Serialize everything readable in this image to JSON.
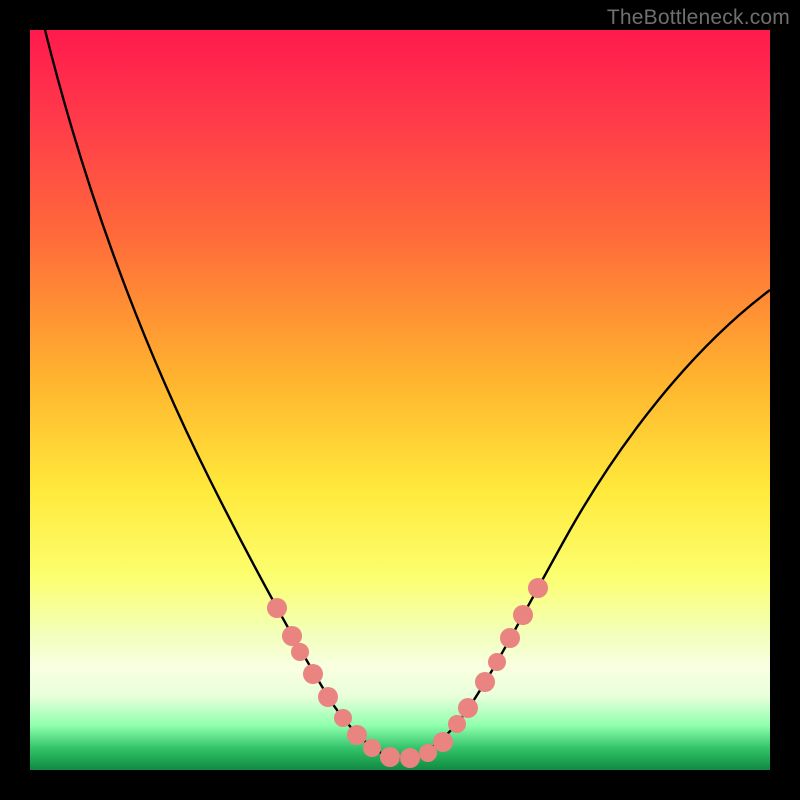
{
  "watermark": "TheBottleneck.com",
  "chart_data": {
    "type": "line",
    "title": "",
    "xlabel": "",
    "ylabel": "",
    "xlim": [
      0,
      100
    ],
    "ylim": [
      0,
      100
    ],
    "grid": false,
    "legend": false,
    "series": [
      {
        "name": "bottleneck-curve",
        "x": [
          2,
          6.5,
          10,
          15,
          20,
          25,
          30,
          33,
          36,
          38,
          40,
          42,
          44,
          46,
          48,
          50,
          52,
          55,
          58,
          62,
          66,
          72,
          80,
          90,
          100
        ],
        "values": [
          100,
          90,
          80,
          67,
          55,
          42,
          30,
          23,
          16,
          12,
          8,
          5,
          3,
          2,
          1.5,
          1.5,
          2,
          3.5,
          6,
          11,
          16,
          24,
          35,
          48,
          60
        ]
      }
    ],
    "annotations": {
      "marker_color": "#e98481",
      "markers_x_pct": [
        32,
        34,
        36,
        38,
        40,
        44,
        48,
        50,
        53,
        55,
        57,
        60,
        62,
        64,
        66
      ],
      "markers_radius_px": 10
    },
    "background_gradient": [
      "#ff1a4d",
      "#ff6b3a",
      "#ffe93b",
      "#8fffad",
      "#148845"
    ]
  }
}
